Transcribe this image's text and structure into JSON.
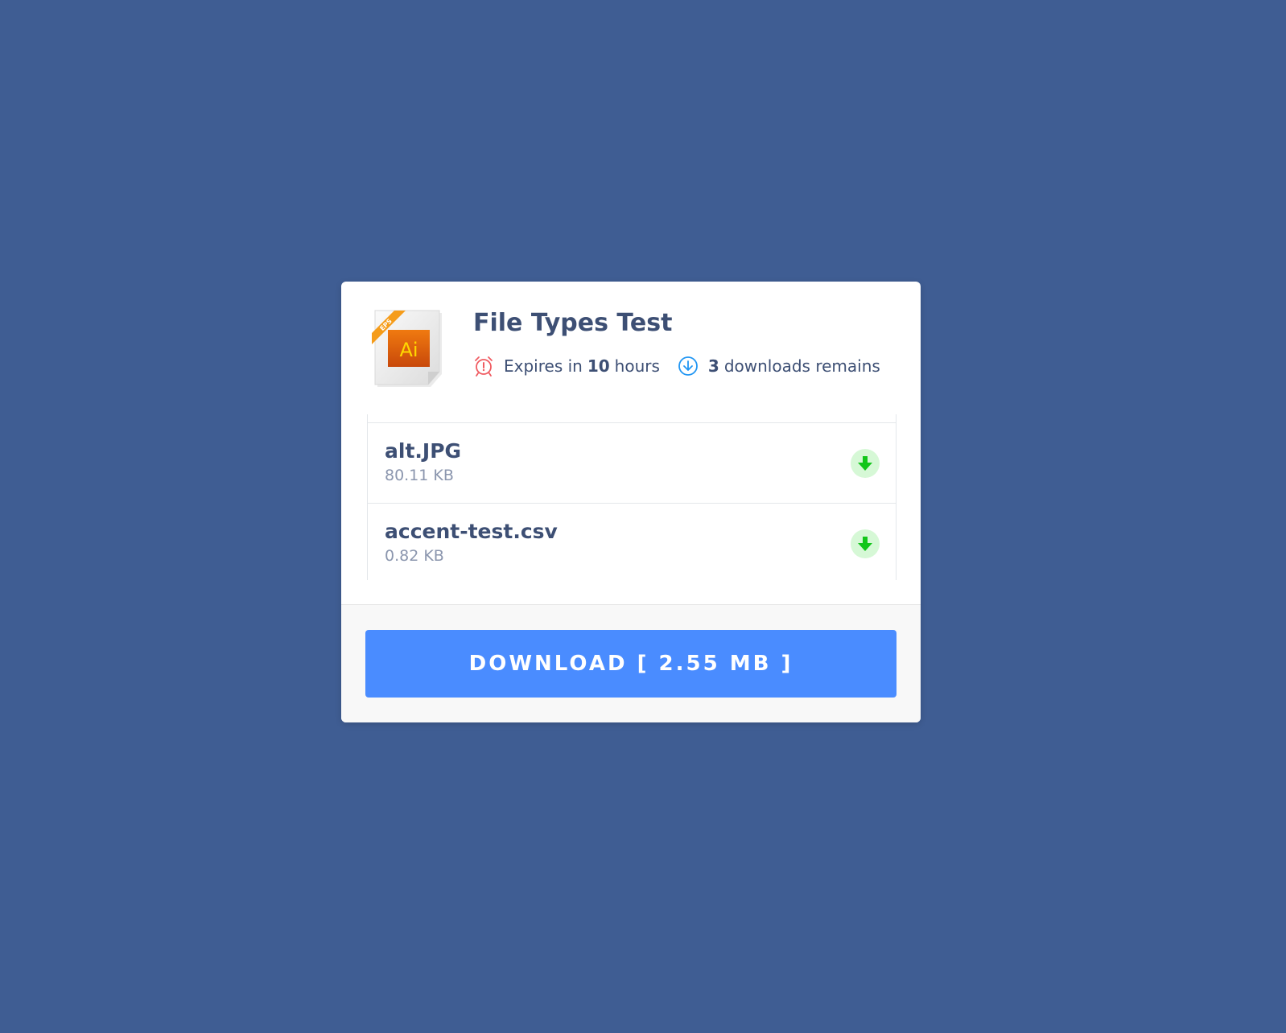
{
  "colors": {
    "background": "#3f5d93",
    "card": "#ffffff",
    "primary_button": "#4a8cff",
    "title_text": "#3d4f74",
    "muted_text": "#8b96ae",
    "expire_icon": "#f05c62",
    "downloads_icon": "#2196f3",
    "file_download_icon": "#12c61a"
  },
  "header": {
    "file_icon": "adobe-illustrator-eps-file-icon",
    "file_icon_text": "Ai",
    "file_icon_ribbon": "EPS",
    "title": "File Types Test",
    "expires": {
      "icon": "alarm-clock-icon",
      "prefix": "Expires in",
      "value": "10",
      "suffix": "hours"
    },
    "downloads": {
      "icon": "download-circle-icon",
      "value": "3",
      "suffix": "downloads remains"
    }
  },
  "files": [
    {
      "name": "alt.JPG",
      "size": "80.11 KB",
      "icon": "download-arrow-icon"
    },
    {
      "name": "accent-test.csv",
      "size": "0.82 KB",
      "icon": "download-arrow-icon"
    }
  ],
  "footer": {
    "download_label": "DOWNLOAD [ 2.55 MB ]"
  }
}
